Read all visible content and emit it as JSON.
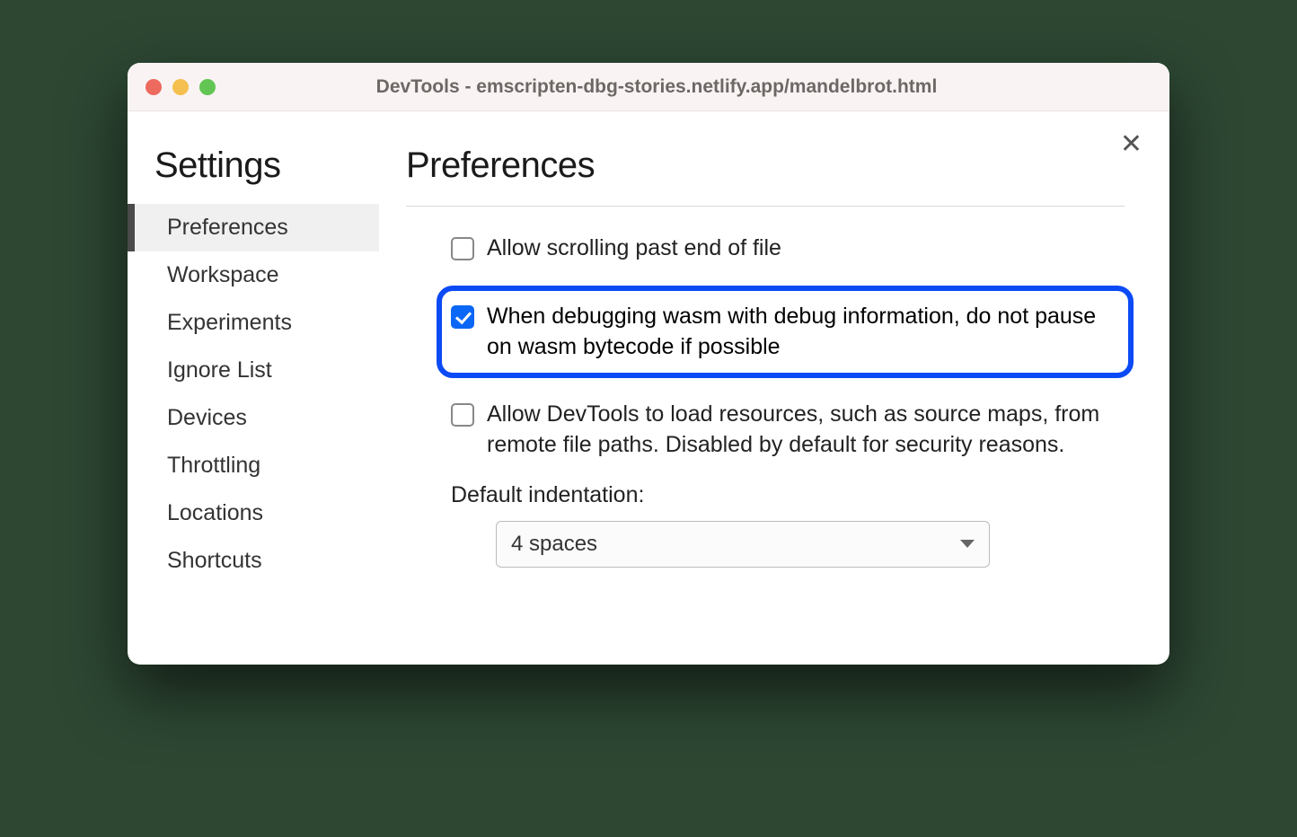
{
  "window": {
    "title": "DevTools - emscripten-dbg-stories.netlify.app/mandelbrot.html"
  },
  "sidebar": {
    "title": "Settings",
    "items": [
      {
        "label": "Preferences",
        "active": true
      },
      {
        "label": "Workspace",
        "active": false
      },
      {
        "label": "Experiments",
        "active": false
      },
      {
        "label": "Ignore List",
        "active": false
      },
      {
        "label": "Devices",
        "active": false
      },
      {
        "label": "Throttling",
        "active": false
      },
      {
        "label": "Locations",
        "active": false
      },
      {
        "label": "Shortcuts",
        "active": false
      }
    ]
  },
  "main": {
    "title": "Preferences",
    "options": [
      {
        "label": "Allow scrolling past end of file",
        "checked": false,
        "highlighted": false
      },
      {
        "label": "When debugging wasm with debug information, do not pause on wasm bytecode if possible",
        "checked": true,
        "highlighted": true
      },
      {
        "label": "Allow DevTools to load resources, such as source maps, from remote file paths. Disabled by default for security reasons.",
        "checked": false,
        "highlighted": false
      }
    ],
    "indentation": {
      "label": "Default indentation:",
      "selected": "4 spaces"
    }
  }
}
